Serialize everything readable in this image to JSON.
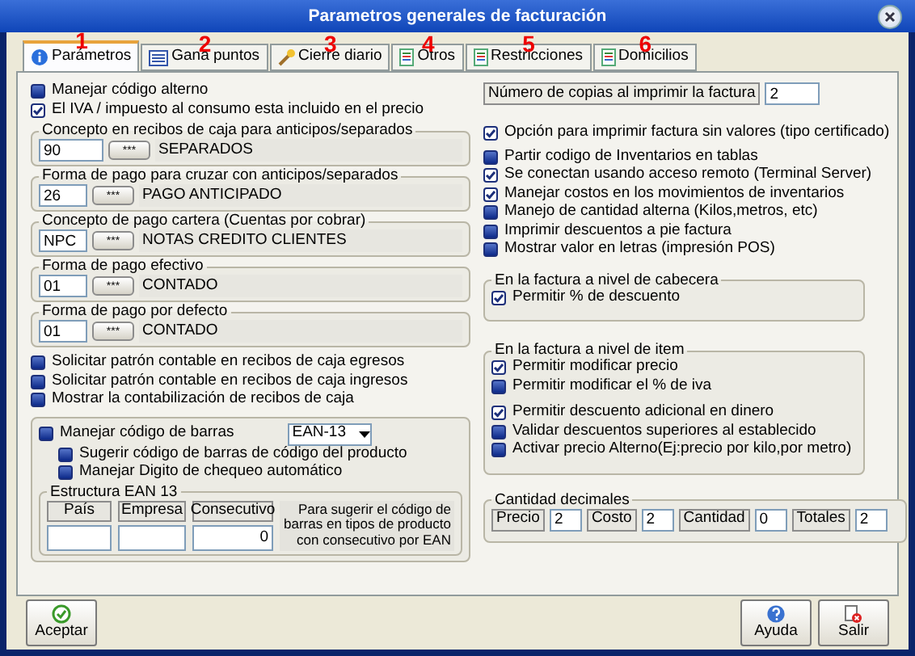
{
  "window": {
    "title": "Parametros generales de facturación"
  },
  "tabs": [
    {
      "label": "Parámetros",
      "marker": "1",
      "kind": "info",
      "selected": true
    },
    {
      "label": "Gana puntos",
      "marker": "2",
      "kind": "list",
      "selected": false
    },
    {
      "label": "Cierre diario",
      "marker": "3",
      "kind": "wand",
      "selected": false
    },
    {
      "label": "Otros",
      "marker": "4",
      "kind": "doc",
      "selected": false
    },
    {
      "label": "Restricciones",
      "marker": "5",
      "kind": "doc",
      "selected": false
    },
    {
      "label": "Domicilios",
      "marker": "6",
      "kind": "doc",
      "selected": false
    }
  ],
  "left": {
    "checks": [
      {
        "label": "Manejar código alterno",
        "checked": false
      },
      {
        "label": "El IVA / impuesto al consumo esta incluido en el precio",
        "checked": true
      }
    ],
    "lookups": [
      {
        "legend": "Concepto en recibos de caja para anticipos/separados",
        "code": "90",
        "button": "***",
        "value": "SEPARADOS"
      },
      {
        "legend": "Forma de pago para cruzar con anticipos/separados",
        "code": "26",
        "button": "***",
        "value": "PAGO ANTICIPADO"
      },
      {
        "legend": "Concepto de pago cartera (Cuentas por cobrar)",
        "code": "NPC",
        "button": "***",
        "value": "NOTAS CREDITO CLIENTES"
      },
      {
        "legend": "Forma de pago efectivo",
        "code": "01",
        "button": "***",
        "value": "CONTADO"
      },
      {
        "legend": "Forma de pago por defecto",
        "code": "01",
        "button": "***",
        "value": "CONTADO"
      }
    ],
    "checks_more": [
      {
        "label": "Solicitar patrón contable en recibos de caja egresos",
        "checked": false
      },
      {
        "label": "Solicitar patrón contable en recibos de caja ingresos",
        "checked": false
      },
      {
        "label": "Mostrar la contabilización de recibos de caja",
        "checked": false
      }
    ],
    "barcode": {
      "check": {
        "label": "Manejar código de barras",
        "checked": false
      },
      "type": "EAN-13",
      "sub_checks": [
        {
          "label": "Sugerir código de barras de código del producto",
          "checked": false
        },
        {
          "label": "Manejar Digito de chequeo automático",
          "checked": false
        }
      ],
      "ean": {
        "legend": "Estructura EAN 13",
        "columns": [
          {
            "label": "País"
          },
          {
            "label": "Empresa"
          },
          {
            "label": "Consecutivo",
            "value": "0"
          }
        ],
        "note": "Para sugerir el código de barras en tipos de producto con consecutivo por EAN"
      }
    }
  },
  "right": {
    "copies": {
      "label": "Número de copias al imprimir la factura",
      "value": "2"
    },
    "checks": [
      {
        "label": "Opción para imprimir factura sin valores (tipo certificado)",
        "checked": true
      }
    ],
    "checks_more": [
      {
        "label": "Partir codigo de Inventarios en tablas",
        "checked": false
      },
      {
        "label": "Se conectan usando acceso remoto (Terminal Server)",
        "checked": true
      },
      {
        "label": "Manejar costos en los movimientos de inventarios",
        "checked": true
      },
      {
        "label": "Manejo de cantidad alterna (Kilos,metros, etc)",
        "checked": false
      },
      {
        "label": "Imprimir descuentos a pie factura",
        "checked": false
      },
      {
        "label": "Mostrar valor en letras (impresión POS)",
        "checked": false
      }
    ],
    "header_group": {
      "legend": "En la factura a nivel  de cabecera",
      "checks": [
        {
          "label": "Permitir % de descuento",
          "checked": true
        }
      ]
    },
    "item_group": {
      "legend": "En la factura a nivel de item",
      "checks": [
        {
          "label": "Permitir modificar precio",
          "checked": true
        },
        {
          "label": "Permitir modificar el % de iva",
          "checked": false
        }
      ],
      "checks_more": [
        {
          "label": "Permitir descuento adicional en dinero",
          "checked": true
        },
        {
          "label": "Validar descuentos superiores al establecido",
          "checked": false
        },
        {
          "label": "Activar precio Alterno(Ej:precio por kilo,por metro)",
          "checked": false
        }
      ]
    },
    "decimals": {
      "legend": "Cantidad decimales",
      "fields": [
        {
          "label": "Precio",
          "value": "2"
        },
        {
          "label": "Costo",
          "value": "2"
        },
        {
          "label": "Cantidad",
          "value": "0"
        },
        {
          "label": "Totales",
          "value": "2"
        }
      ]
    }
  },
  "buttons": [
    {
      "label": "Aceptar",
      "kind": "ok"
    },
    {
      "label": "Ayuda",
      "kind": "help"
    },
    {
      "label": "Salir",
      "kind": "exit"
    }
  ]
}
